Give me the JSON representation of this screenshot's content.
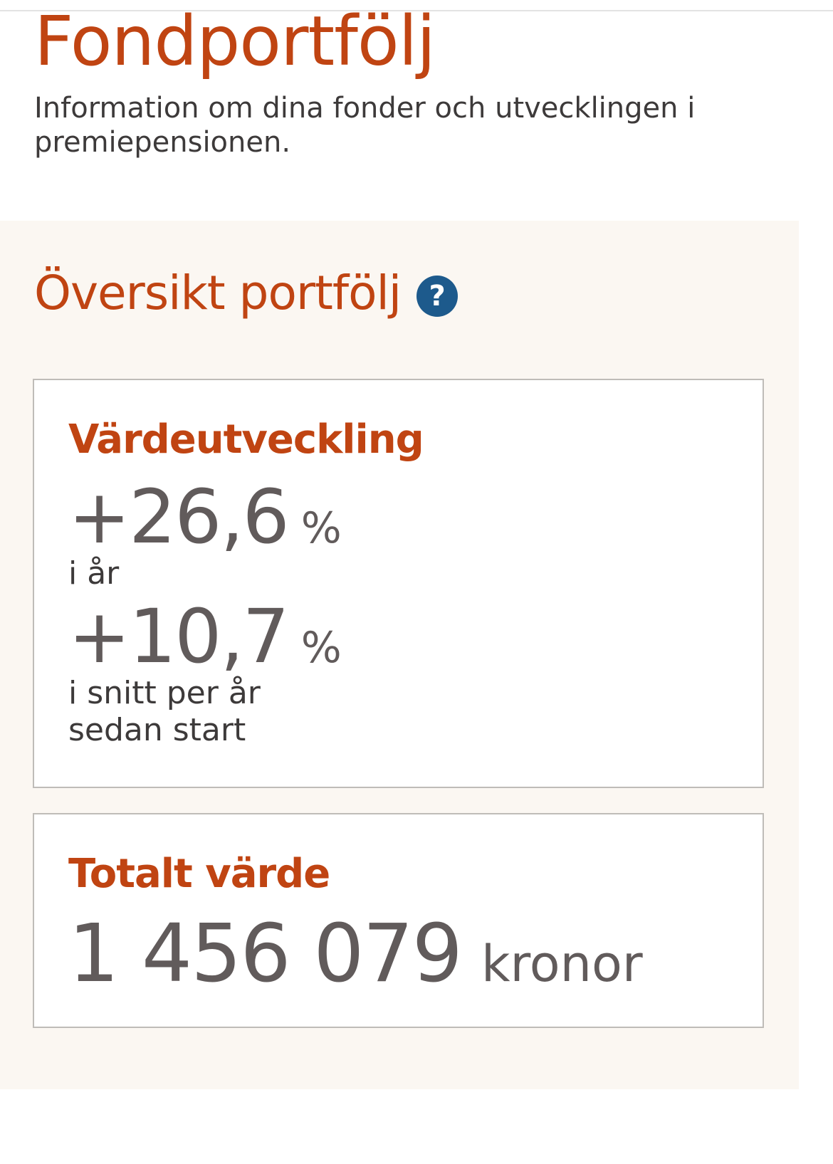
{
  "header": {
    "title": "Fondportfölj",
    "intro": "Information om dina fonder och utvecklingen i premiepensionen."
  },
  "overview": {
    "title": "Översikt portfölj",
    "help_icon": "?"
  },
  "value_development": {
    "label": "Värdeutveckling",
    "this_year": {
      "value": "+26,6",
      "unit": "%",
      "description": "i år"
    },
    "since_start": {
      "value": "+10,7",
      "unit": "%",
      "description": "i snitt per år sedan start"
    }
  },
  "total_value": {
    "label": "Totalt värde",
    "amount": "1 456 079",
    "unit": "kronor"
  },
  "colors": {
    "accent": "#c04412",
    "text": "#3d3a3a",
    "number": "#615b5b",
    "section_bg": "#fbf7f2",
    "help_icon_bg": "#1d5a8c"
  }
}
